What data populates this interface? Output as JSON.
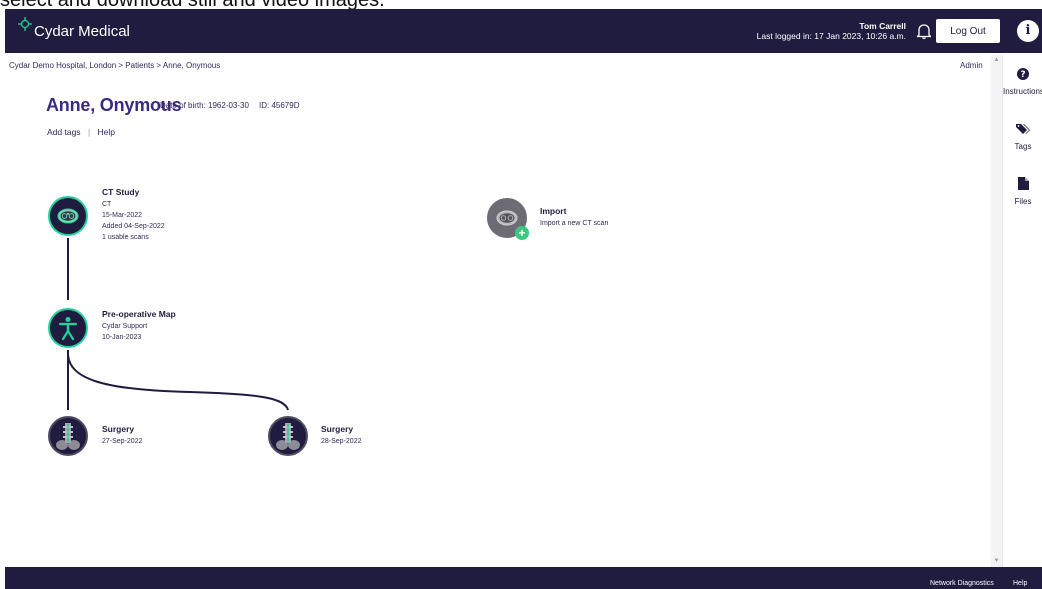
{
  "caption": "select and download still and video images.",
  "header": {
    "app_name": "Cydar Medical",
    "user_name": "Tom Carrell",
    "last_logged": "Last logged in: 17 Jan 2023, 10:26 a.m.",
    "logout_label": "Log Out",
    "info_label": "i",
    "bg_color": "#201c40"
  },
  "breadcrumb": "Cydar Demo Hospital, London > Patients > Anne, Onymous",
  "admin_label": "Admin",
  "patient": {
    "name": "Anne, Onymous",
    "dob": "Date of birth: 1962-03-30",
    "id": "ID: 45679D"
  },
  "actions": {
    "add_tags": "Add tags",
    "separator": "|",
    "help": "Help"
  },
  "sidebar": {
    "items": [
      {
        "label": "Instructions",
        "icon": "question-icon"
      },
      {
        "label": "Tags",
        "icon": "tags-icon"
      },
      {
        "label": "Files",
        "icon": "file-icon"
      }
    ]
  },
  "timeline": {
    "ct_study": {
      "title": "CT Study",
      "lines": [
        "CT",
        "15-Mar-2022",
        "Added 04-Sep-2022",
        "1 usable scans"
      ]
    },
    "import": {
      "title": "Import",
      "subtitle": "Import a new CT scan"
    },
    "preop": {
      "title": "Pre-operative Map",
      "lines": [
        "Cydar Support",
        "10-Jan-2023"
      ]
    },
    "surgery1": {
      "title": "Surgery",
      "date": "27-Sep-2022"
    },
    "surgery2": {
      "title": "Surgery",
      "date": "28-Sep-2022"
    }
  },
  "footer": {
    "network": "Network Diagnostics",
    "help": "Help"
  },
  "colors": {
    "accent": "#1fd39a",
    "primary": "#201c40",
    "name": "#3a2a84",
    "import_plus": "#39c97e"
  }
}
